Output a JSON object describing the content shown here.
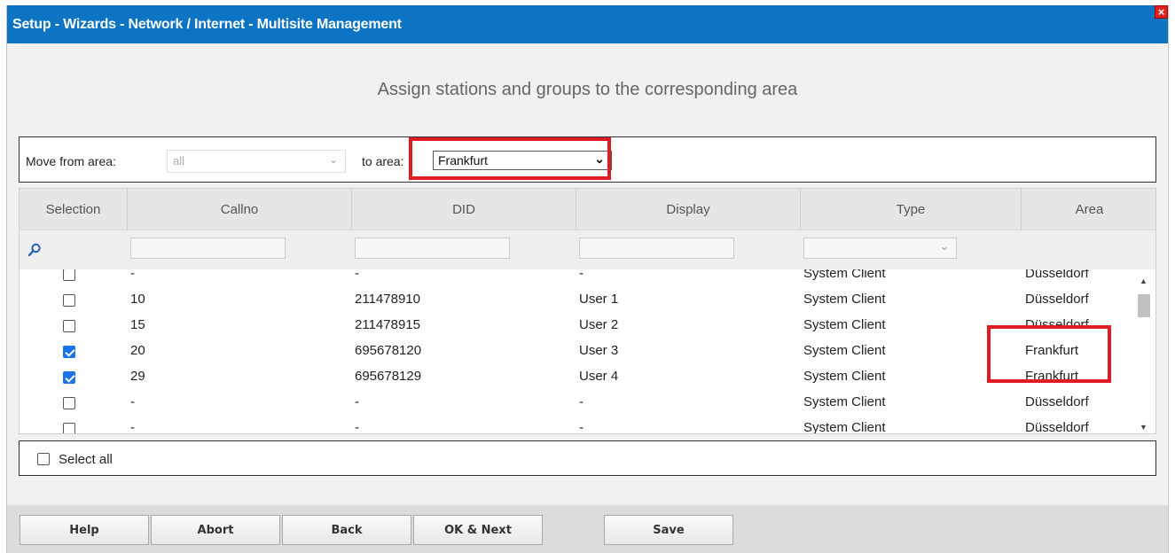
{
  "window": {
    "title": "Setup - Wizards - Network / Internet - Multisite Management",
    "close_label": "×"
  },
  "heading": "Assign stations and groups to the corresponding area",
  "move": {
    "from_label": "Move from area:",
    "from_value": "all",
    "to_label": "to area:",
    "to_value": "Frankfurt"
  },
  "columns": [
    "Selection",
    "Callno",
    "DID",
    "Display",
    "Type",
    "Area"
  ],
  "rows": [
    {
      "checked": false,
      "callno": "-",
      "did": "-",
      "display": "-",
      "type": "System Client",
      "area": "Düsseldorf"
    },
    {
      "checked": false,
      "callno": "10",
      "did": "211478910",
      "display": "User 1",
      "type": "System Client",
      "area": "Düsseldorf"
    },
    {
      "checked": false,
      "callno": "15",
      "did": "211478915",
      "display": "User 2",
      "type": "System Client",
      "area": "Düsseldorf"
    },
    {
      "checked": true,
      "callno": "20",
      "did": "695678120",
      "display": "User 3",
      "type": "System Client",
      "area": "Frankfurt"
    },
    {
      "checked": true,
      "callno": "29",
      "did": "695678129",
      "display": "User 4",
      "type": "System Client",
      "area": "Frankfurt"
    },
    {
      "checked": false,
      "callno": "-",
      "did": "-",
      "display": "-",
      "type": "System Client",
      "area": "Düsseldorf"
    },
    {
      "checked": false,
      "callno": "-",
      "did": "-",
      "display": "-",
      "type": "System Client",
      "area": "Düsseldorf"
    }
  ],
  "select_all_label": "Select all",
  "buttons": {
    "help": "Help",
    "abort": "Abort",
    "back": "Back",
    "ok_next": "OK & Next",
    "save": "Save"
  },
  "colors": {
    "titlebar": "#0d74c4",
    "highlight": "#e01b24",
    "checkbox_checked": "#1a73e8"
  }
}
